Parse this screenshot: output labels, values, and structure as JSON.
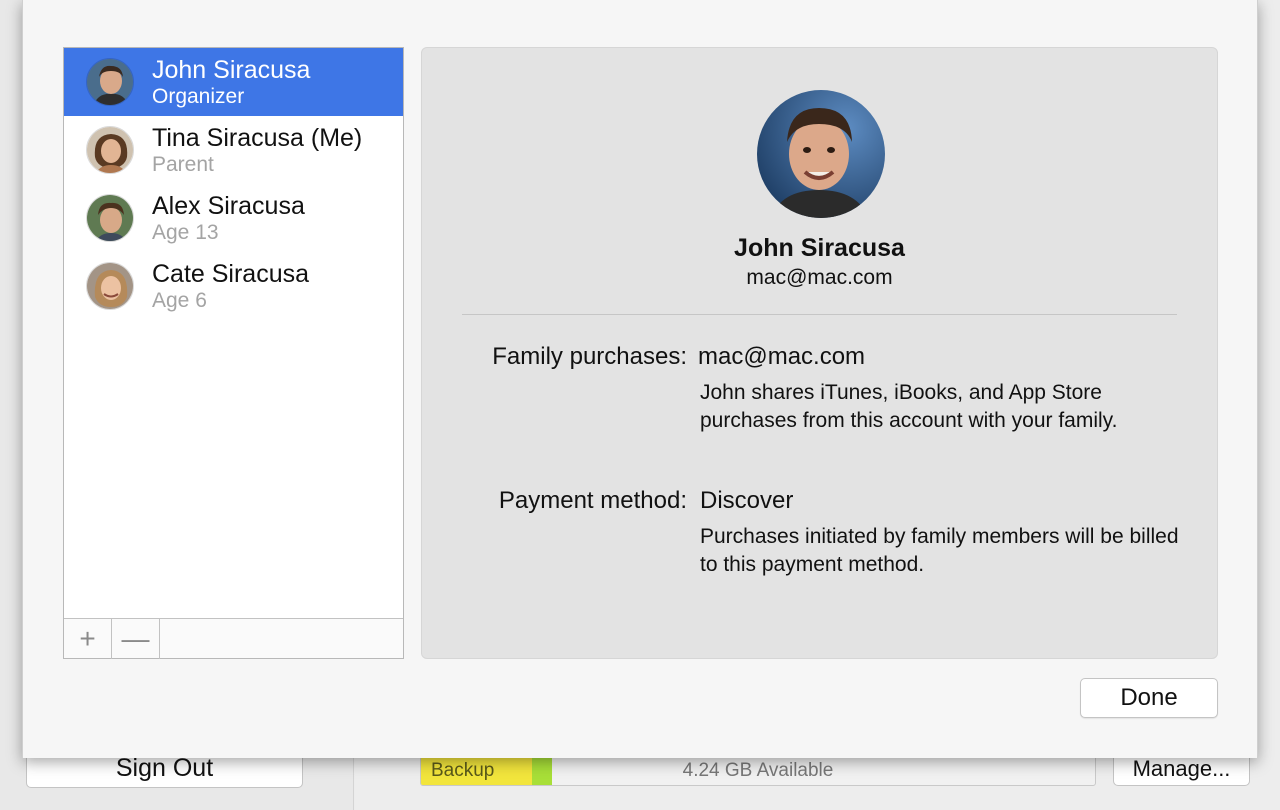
{
  "background": {
    "sign_out_label": "Sign Out",
    "storage": {
      "backup_label": "Backup",
      "available_label": "4.24 GB Available",
      "backup_fraction": 0.165,
      "other_fraction": 0.03,
      "backup_color": "#f2e53c",
      "other_color": "#a8df38"
    },
    "manage_label": "Manage..."
  },
  "members": [
    {
      "name": "John Siracusa",
      "role": "Organizer",
      "selected": true,
      "avatar_icon": "person-photo-icon"
    },
    {
      "name": "Tina Siracusa (Me)",
      "role": "Parent",
      "selected": false,
      "avatar_icon": "person-photo-icon"
    },
    {
      "name": "Alex Siracusa",
      "role": "Age 13",
      "selected": false,
      "avatar_icon": "person-photo-icon"
    },
    {
      "name": "Cate Siracusa",
      "role": "Age 6",
      "selected": false,
      "avatar_icon": "person-photo-icon"
    }
  ],
  "list_toolbar": {
    "add_glyph": "+",
    "remove_glyph": "—"
  },
  "detail": {
    "name": "John Siracusa",
    "email": "mac@mac.com",
    "family_purchases_label": "Family purchases:",
    "family_purchases_value": "mac@mac.com",
    "family_purchases_desc": "John shares iTunes, iBooks, and App Store purchases from this account with your family.",
    "payment_method_label": "Payment method:",
    "payment_method_value": "Discover",
    "payment_method_desc": "Purchases initiated by family members will be billed to this payment method."
  },
  "done_label": "Done",
  "colors": {
    "selection": "#3e76e6"
  }
}
